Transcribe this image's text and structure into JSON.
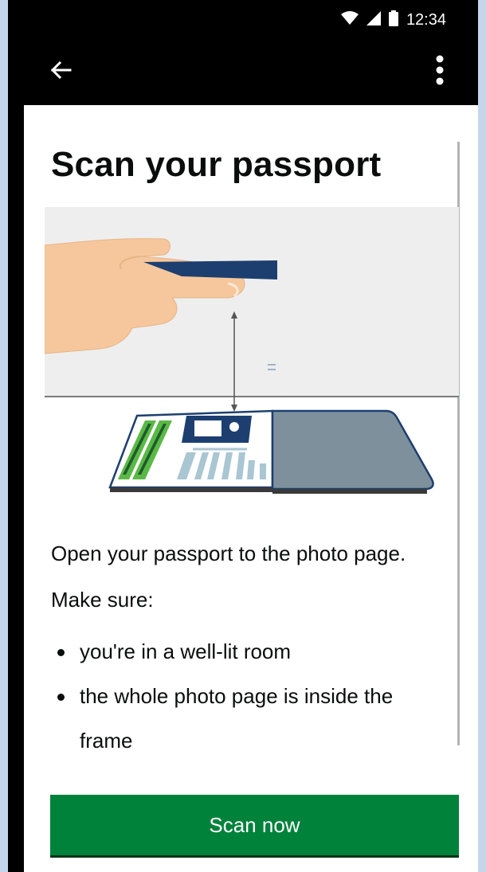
{
  "status_bar": {
    "time": "12:34",
    "icons": [
      "wifi-icon",
      "signal-icon",
      "battery-icon"
    ]
  },
  "app_bar": {
    "back_icon": "arrow-left-icon",
    "menu_icon": "more-vertical-icon"
  },
  "page": {
    "title": "Scan your passport",
    "instruction": "Open your passport to the photo page.",
    "make_sure_label": "Make sure:",
    "bullets": [
      "you're in a well-lit room",
      "the whole photo page is inside the frame"
    ]
  },
  "actions": {
    "scan_label": "Scan now"
  },
  "colors": {
    "primary_button": "#00823b",
    "text": "#0b0c0c",
    "passport_blue": "#1d3f70",
    "passport_cover": "#7e909c",
    "highlight_green": "#5ab946"
  }
}
